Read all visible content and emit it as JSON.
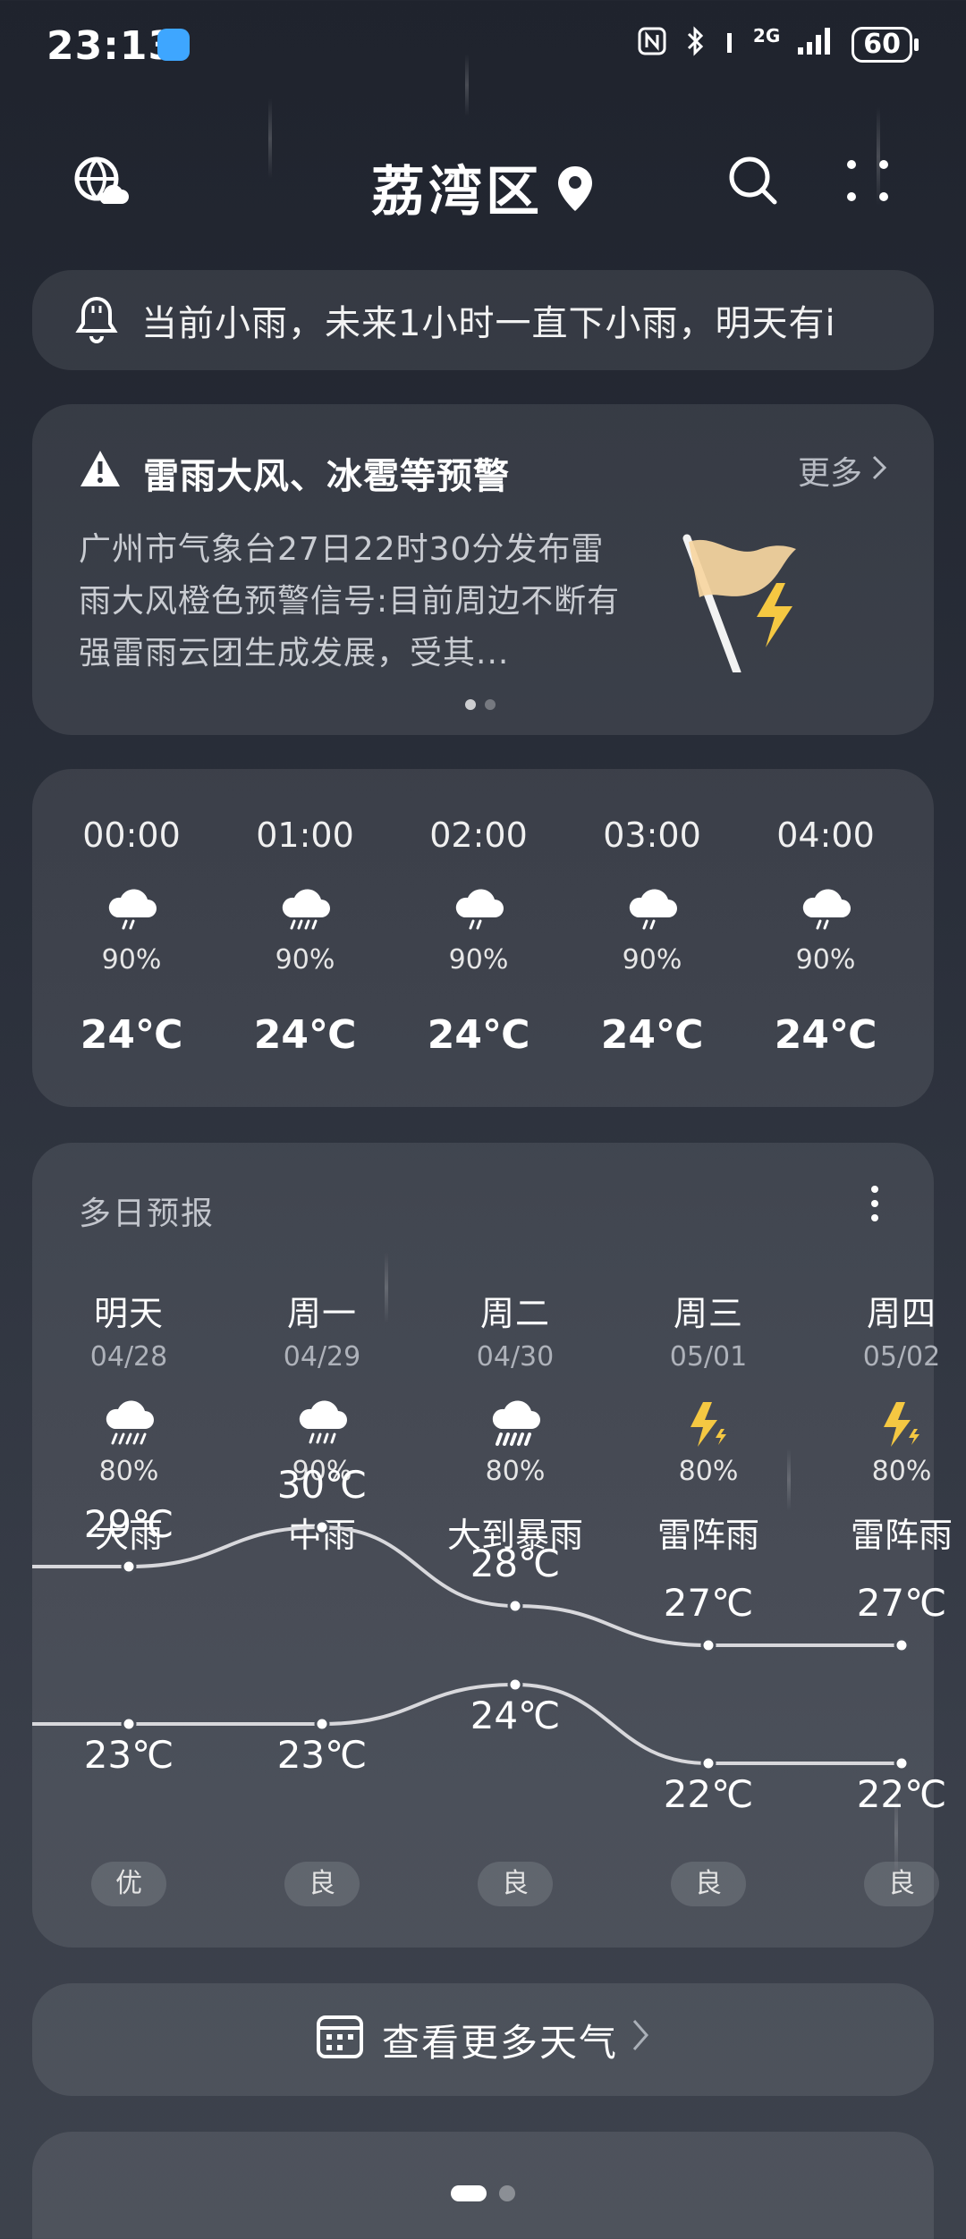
{
  "status_bar": {
    "time": "23:13",
    "network": "2G",
    "battery": "60"
  },
  "header": {
    "title": "荔湾区"
  },
  "alert_bar": {
    "text": "当前小雨，未来1小时一直下小雨，明天有i"
  },
  "warning": {
    "title": "雷雨大风、冰雹等预警",
    "more": "更多",
    "body": "广州市气象台27日22时30分发布雷雨大风橙色预警信号:目前周边不断有强雷雨云团生成发展，受其..."
  },
  "hourly": [
    {
      "time": "00:00",
      "precip": "90%",
      "temp": "24℃",
      "icon": "rain-cloud-icon"
    },
    {
      "time": "01:00",
      "precip": "90%",
      "temp": "24℃",
      "icon": "rain-cloud-icon"
    },
    {
      "time": "02:00",
      "precip": "90%",
      "temp": "24℃",
      "icon": "rain-cloud-icon"
    },
    {
      "time": "03:00",
      "precip": "90%",
      "temp": "24℃",
      "icon": "rain-cloud-icon"
    },
    {
      "time": "04:00",
      "precip": "90%",
      "temp": "24℃",
      "icon": "rain-cloud-icon"
    }
  ],
  "daily": {
    "title": "多日预报",
    "days": [
      {
        "day": "明天",
        "date": "04/28",
        "precip": "80%",
        "cond": "大雨",
        "icon": "heavy-rain-icon",
        "high": "29℃",
        "low": "23℃",
        "high_val": 29,
        "low_val": 23,
        "aqi": "优"
      },
      {
        "day": "周一",
        "date": "04/29",
        "precip": "90%",
        "cond": "中雨",
        "icon": "moderate-rain-icon",
        "high": "30℃",
        "low": "23℃",
        "high_val": 30,
        "low_val": 23,
        "aqi": "良"
      },
      {
        "day": "周二",
        "date": "04/30",
        "precip": "80%",
        "cond": "大到暴雨",
        "icon": "storm-rain-icon",
        "high": "28℃",
        "low": "24℃",
        "high_val": 28,
        "low_val": 24,
        "aqi": "良"
      },
      {
        "day": "周三",
        "date": "05/01",
        "precip": "80%",
        "cond": "雷阵雨",
        "icon": "thunder-icon",
        "high": "27℃",
        "low": "22℃",
        "high_val": 27,
        "low_val": 22,
        "aqi": "良"
      },
      {
        "day": "周四",
        "date": "05/02",
        "precip": "80%",
        "cond": "雷阵雨",
        "icon": "thunder-icon",
        "high": "27℃",
        "low": "22℃",
        "high_val": 27,
        "low_val": 22,
        "aqi": "良"
      }
    ]
  },
  "more_weather": {
    "label": "查看更多天气"
  },
  "colors": {
    "lightning": "#f5c842",
    "flag": "#f7d6a1",
    "curve": "#d8d8dc"
  }
}
